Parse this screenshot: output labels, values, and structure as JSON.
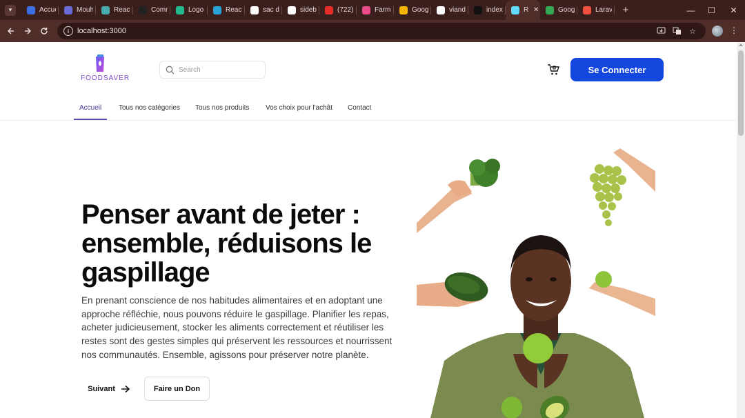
{
  "browser": {
    "tabs": [
      {
        "label": "Accue",
        "icon": "chrome-c-icon",
        "color": "#3c6fe0"
      },
      {
        "label": "Mouh",
        "icon": "profile-icon",
        "color": "#6b6bd8"
      },
      {
        "label": "React",
        "icon": "react-icon",
        "color": "#4aa"
      },
      {
        "label": "Comn",
        "icon": "github-icon",
        "color": "#222"
      },
      {
        "label": "Logo",
        "icon": "leaf-icon",
        "color": "#25b88f"
      },
      {
        "label": "React",
        "icon": "react-icon",
        "color": "#2aa4d8"
      },
      {
        "label": "sac de",
        "icon": "google-icon",
        "color": "#ffffff"
      },
      {
        "label": "sideba",
        "icon": "google-icon",
        "color": "#ffffff"
      },
      {
        "label": "(722)",
        "icon": "youtube-icon",
        "color": "#e52d27"
      },
      {
        "label": "Farmg",
        "icon": "dribbble-icon",
        "color": "#ea4c89"
      },
      {
        "label": "Goog",
        "icon": "google-drive-icon",
        "color": "#f4b400"
      },
      {
        "label": "viande",
        "icon": "google-icon",
        "color": "#ffffff"
      },
      {
        "label": "index",
        "icon": "terminal-icon",
        "color": "#111"
      },
      {
        "label": "R",
        "icon": "react-icon",
        "color": "#61dafb",
        "active": true
      },
      {
        "label": "Goog",
        "icon": "google-drive-icon",
        "color": "#34a853"
      },
      {
        "label": "Larav",
        "icon": "laravel-icon",
        "color": "#f0513f"
      }
    ],
    "url": "localhost:3000",
    "controls": {
      "minimize": "—",
      "maximize": "☐",
      "close": "✕"
    }
  },
  "header": {
    "logo_text": "FOODSAVER",
    "search_placeholder": "Search",
    "login_label": "Se Connecter"
  },
  "nav": {
    "items": [
      {
        "label": "Accueil",
        "active": true
      },
      {
        "label": "Tous nos catégories"
      },
      {
        "label": "Tous nos produits"
      },
      {
        "label": "Vos choix pour l'achât"
      },
      {
        "label": "Contact"
      }
    ]
  },
  "hero": {
    "title": "Penser avant de jeter : ensemble, réduisons le gaspillage",
    "text": "En prenant conscience de nos habitudes alimentaires et en adoptant une approche réfléchie, nous pouvons réduire le gaspillage. Planifier les repas, acheter judicieusement, stocker les aliments correctement et réutiliser les restes sont des gestes simples qui préservent les ressources et nourrissent nos communautés. Ensemble, agissons pour préserver notre planète.",
    "next_label": "Suivant",
    "donate_label": "Faire un Don"
  },
  "colors": {
    "primary": "#1447dd",
    "accent": "#5b4ab0",
    "browser_frame": "#3a1f1c"
  }
}
